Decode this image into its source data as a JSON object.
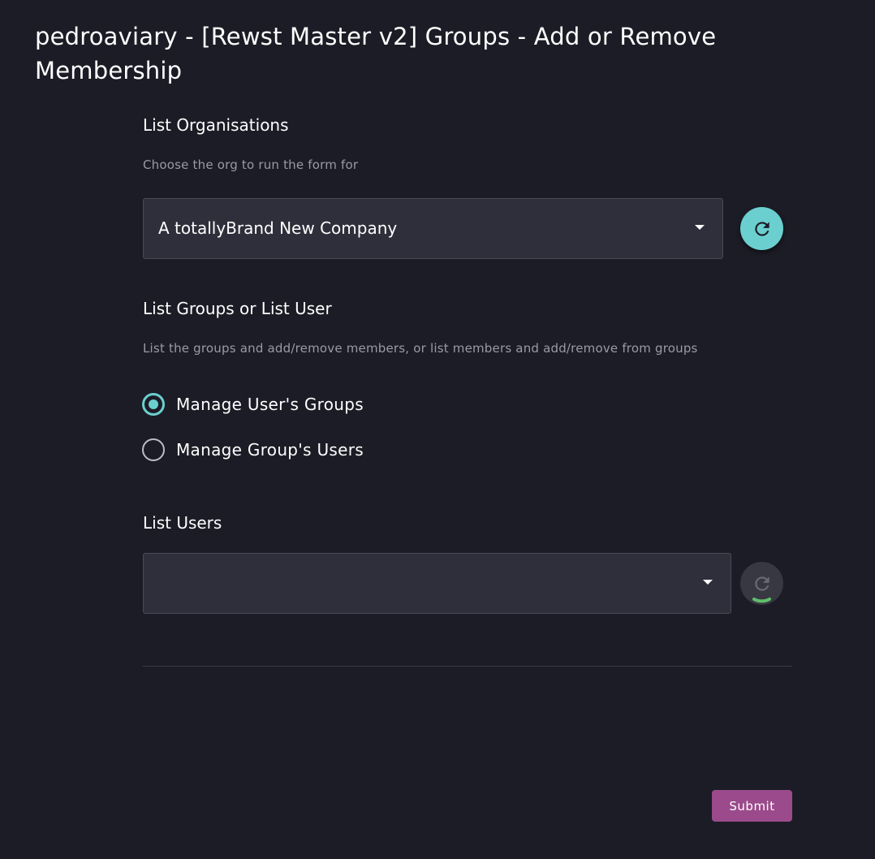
{
  "page": {
    "title": "pedroaviary - [Rewst Master v2] Groups - Add or Remove Membership"
  },
  "org_section": {
    "heading": "List Organisations",
    "description": "Choose the org to run the form for",
    "selected_value": "A totallyBrand New Company",
    "refresh_icon": "refresh-icon",
    "refresh_state": "enabled"
  },
  "mode_section": {
    "heading": "List Groups or List User",
    "description": "List the groups and add/remove members, or list members and add/remove from groups",
    "options": [
      {
        "label": "Manage User's Groups",
        "checked": true
      },
      {
        "label": "Manage Group's Users",
        "checked": false
      }
    ]
  },
  "users_section": {
    "heading": "List Users",
    "selected_value": "",
    "refresh_icon": "refresh-icon",
    "refresh_state": "loading"
  },
  "footer": {
    "submit_label": "Submit"
  },
  "colors": {
    "background": "#1c1c26",
    "accent_teal": "#6bcfcf",
    "submit_purple": "#9b4a8b",
    "loading_green": "#5fbf6a"
  }
}
